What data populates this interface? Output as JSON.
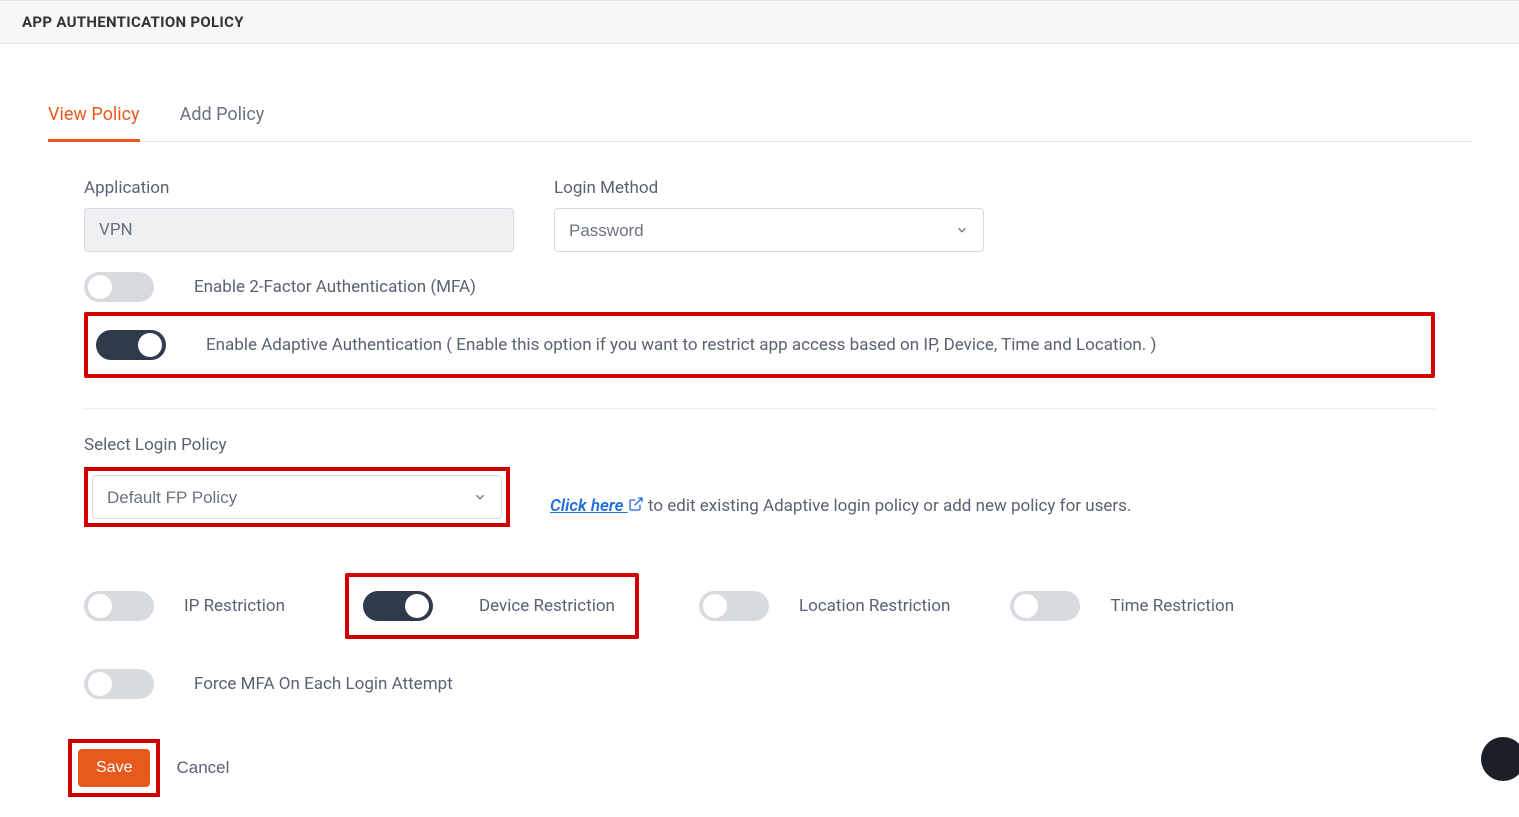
{
  "header": {
    "title": "APP AUTHENTICATION POLICY"
  },
  "tabs": {
    "view": "View Policy",
    "add": "Add Policy"
  },
  "labels": {
    "application": "Application",
    "login_method": "Login Method",
    "select_login_policy": "Select Login Policy"
  },
  "fields": {
    "application_value": "VPN",
    "login_method_value": "Password",
    "login_policy_value": "Default FP Policy"
  },
  "toggles": {
    "mfa": "Enable 2-Factor Authentication (MFA)",
    "adaptive": "Enable Adaptive Authentication ( Enable this option if you want to restrict app access based on IP, Device, Time and Location. )",
    "ip_restriction": "IP Restriction",
    "device_restriction": "Device Restriction",
    "location_restriction": "Location Restriction",
    "time_restriction": "Time Restriction",
    "force_mfa": "Force MFA On Each Login Attempt"
  },
  "hint": {
    "click_here": "Click here",
    "rest": " to edit existing Adaptive login policy or add new policy for users."
  },
  "buttons": {
    "save": "Save",
    "cancel": "Cancel"
  }
}
